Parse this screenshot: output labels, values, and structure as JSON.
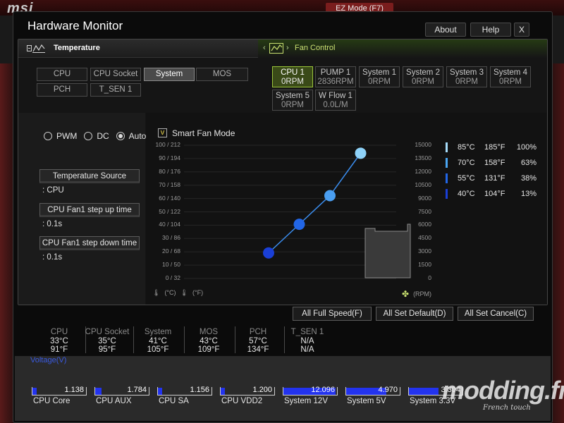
{
  "background": {
    "ez_mode": "EZ Mode (F7)"
  },
  "window": {
    "title": "Hardware Monitor",
    "buttons": {
      "about": "About",
      "help": "Help",
      "close": "X"
    }
  },
  "temperature": {
    "header": "Temperature",
    "sources": [
      {
        "label": "CPU",
        "active": false
      },
      {
        "label": "CPU Socket",
        "active": false
      },
      {
        "label": "System",
        "active": true
      },
      {
        "label": "MOS",
        "active": false
      },
      {
        "label": "PCH",
        "active": false
      },
      {
        "label": "T_SEN 1",
        "active": false
      }
    ]
  },
  "fan_control": {
    "header": "Fan Control",
    "fans": [
      {
        "name": "CPU 1",
        "rpm": "0RPM",
        "active": true
      },
      {
        "name": "PUMP 1",
        "rpm": "2836RPM",
        "active": false
      },
      {
        "name": "System 1",
        "rpm": "0RPM",
        "active": false
      },
      {
        "name": "System 2",
        "rpm": "0RPM",
        "active": false
      },
      {
        "name": "System 3",
        "rpm": "0RPM",
        "active": false
      },
      {
        "name": "System 4",
        "rpm": "0RPM",
        "active": false
      },
      {
        "name": "System 5",
        "rpm": "0RPM",
        "active": false
      },
      {
        "name": "W Flow 1",
        "rpm": "0.0L/M",
        "active": false
      }
    ]
  },
  "mode": {
    "pwm": "PWM",
    "dc": "DC",
    "auto": "Auto",
    "selected": "Auto"
  },
  "temp_source": {
    "label": "Temperature Source",
    "value": ": CPU"
  },
  "step_up": {
    "label": "CPU Fan1 step up time",
    "value": ": 0.1s"
  },
  "step_down": {
    "label": "CPU Fan1 step down time",
    "value": ": 0.1s"
  },
  "smart_fan": {
    "label": "Smart Fan Mode",
    "checked": "v"
  },
  "chart_data": {
    "type": "line",
    "left_axis_ticks": [
      "100 / 212",
      "90 / 194",
      "80 / 176",
      "70 / 158",
      "60 / 140",
      "50 / 122",
      "40 / 104",
      "30 /  86",
      "20 /  68",
      "10 /  50",
      "0 /  32"
    ],
    "right_axis_ticks": [
      "15000",
      "13500",
      "12000",
      "10500",
      "9000",
      "7500",
      "6000",
      "4500",
      "3000",
      "1500",
      "0"
    ],
    "xlabel_c": "(°C)",
    "xlabel_f": "(°F)",
    "rpm_label": "(RPM)",
    "ylim": [
      0,
      100
    ],
    "points": [
      {
        "temp_c": 40,
        "percent": 13,
        "color": "#1a3fd6"
      },
      {
        "temp_c": 55,
        "percent": 38,
        "color": "#2266e6"
      },
      {
        "temp_c": 70,
        "percent": 63,
        "color": "#4a9ef0"
      },
      {
        "temp_c": 85,
        "percent": 100,
        "color": "#8ed2f8"
      }
    ],
    "legend": [
      {
        "c": "85°C",
        "f": "185°F",
        "p": "100%",
        "color": "#a6dcfa"
      },
      {
        "c": "70°C",
        "f": "158°F",
        "p": "63%",
        "color": "#4aa6f2"
      },
      {
        "c": "55°C",
        "f": "131°F",
        "p": "38%",
        "color": "#2266e6"
      },
      {
        "c": "40°C",
        "f": "104°F",
        "p": "13%",
        "color": "#1a3fd6"
      }
    ]
  },
  "actions": {
    "full_speed": "All Full Speed(F)",
    "set_default": "All Set Default(D)",
    "set_cancel": "All Set Cancel(C)"
  },
  "temps": [
    {
      "name": "CPU",
      "c": "33°C",
      "f": "91°F"
    },
    {
      "name": "CPU Socket",
      "c": "35°C",
      "f": "95°F"
    },
    {
      "name": "System",
      "c": "41°C",
      "f": "105°F"
    },
    {
      "name": "MOS",
      "c": "43°C",
      "f": "109°F"
    },
    {
      "name": "PCH",
      "c": "57°C",
      "f": "134°F"
    },
    {
      "name": "T_SEN 1",
      "c": "N/A",
      "f": "N/A"
    }
  ],
  "voltage": {
    "title": "Voltage(V)",
    "items": [
      {
        "name": "CPU Core",
        "value": "1.138",
        "level": 0.08
      },
      {
        "name": "CPU AUX",
        "value": "1.784",
        "level": 0.12
      },
      {
        "name": "CPU SA",
        "value": "1.156",
        "level": 0.08
      },
      {
        "name": "CPU VDD2",
        "value": "1.200",
        "level": 0.08
      },
      {
        "name": "System 12V",
        "value": "12.096",
        "level": 0.98
      },
      {
        "name": "System 5V",
        "value": "4.970",
        "level": 0.75
      },
      {
        "name": "System 3.3V",
        "value": "3.304",
        "level": 0.55
      }
    ]
  },
  "watermark": {
    "main": "modding.fr",
    "sub": "French touch"
  }
}
